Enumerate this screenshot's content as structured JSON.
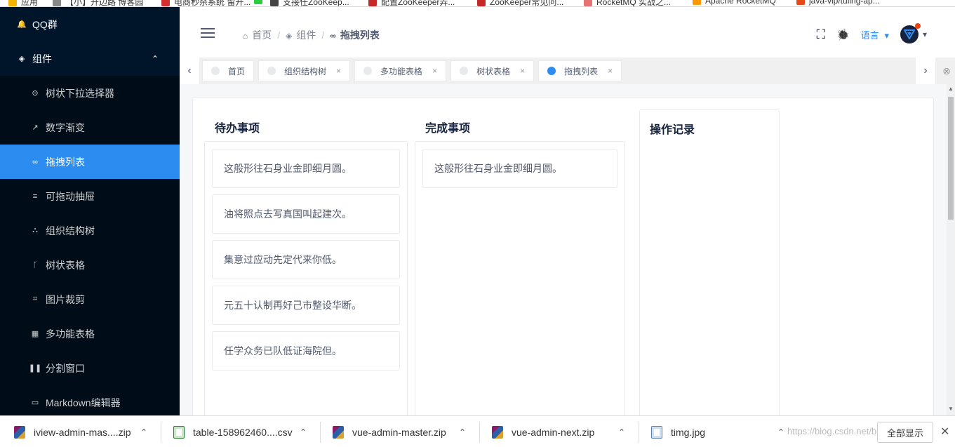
{
  "bookmarks": [
    {
      "label": "应用",
      "color": "#f4b400"
    },
    {
      "label": "【小】开边路 博客园",
      "color": "#888888"
    },
    {
      "label": "电商秒杀系统 留开...",
      "color": "#d32f2f"
    },
    {
      "label": "",
      "color": "#2ecc40"
    },
    {
      "label": "支接任ZooKeep...",
      "color": "#444444"
    },
    {
      "label": "配置ZooKeeper弄...",
      "color": "#c62828"
    },
    {
      "label": "ZooKeeper常见问...",
      "color": "#c62828"
    },
    {
      "label": "RocketMQ 实战之...",
      "color": "#e57373"
    },
    {
      "label": "Apache RocketMQ",
      "color": "#ff9800"
    },
    {
      "label": "java-vip/tuling-ap...",
      "color": "#e64a19"
    }
  ],
  "sidebar": {
    "items": [
      {
        "label": "QQ群",
        "icon": "bell-icon",
        "glyph": "🔔",
        "type": "top"
      },
      {
        "label": "组件",
        "icon": "layers-icon",
        "glyph": "◈",
        "type": "top",
        "chevron": "⌃"
      },
      {
        "label": "树状下拉选择器",
        "icon": "arrow-down-circle-icon",
        "glyph": "⊝",
        "type": "sub"
      },
      {
        "label": "数字渐变",
        "icon": "trending-icon",
        "glyph": "↗",
        "type": "sub"
      },
      {
        "label": "拖拽列表",
        "icon": "infinity-icon",
        "glyph": "∞",
        "type": "sub",
        "active": true
      },
      {
        "label": "可拖动抽屉",
        "icon": "list-icon",
        "glyph": "≡",
        "type": "sub"
      },
      {
        "label": "组织结构树",
        "icon": "people-icon",
        "glyph": "⛬",
        "type": "sub"
      },
      {
        "label": "树状表格",
        "icon": "branch-icon",
        "glyph": "ᚴ",
        "type": "sub"
      },
      {
        "label": "图片裁剪",
        "icon": "crop-icon",
        "glyph": "⌗",
        "type": "sub"
      },
      {
        "label": "多功能表格",
        "icon": "grid-icon",
        "glyph": "▦",
        "type": "sub"
      },
      {
        "label": "分割窗口",
        "icon": "pause-icon",
        "glyph": "❚❚",
        "type": "sub"
      },
      {
        "label": "Markdown编辑器",
        "icon": "markdown-icon",
        "glyph": "▭",
        "type": "sub"
      }
    ]
  },
  "header": {
    "breadcrumb": [
      {
        "label": "首页",
        "icon": "home-icon",
        "glyph": "⌂"
      },
      {
        "label": "组件",
        "icon": "layers-icon",
        "glyph": "◈"
      },
      {
        "label": "拖拽列表",
        "icon": "infinity-icon",
        "glyph": "∞"
      }
    ],
    "breadcrumb_sep": "/",
    "fullscreen_glyph": "⛶",
    "bug_glyph": "🐞",
    "language_label": "语言",
    "language_caret": "▾",
    "user_caret": "▾"
  },
  "tagbar": {
    "left_arrow": "‹",
    "right_arrow": "›",
    "close_all": "⊗",
    "close_glyph": "×",
    "tags": [
      {
        "label": "首页",
        "closable": false,
        "active": false
      },
      {
        "label": "组织结构树",
        "closable": true,
        "active": false
      },
      {
        "label": "多功能表格",
        "closable": true,
        "active": false
      },
      {
        "label": "树状表格",
        "closable": true,
        "active": false
      },
      {
        "label": "拖拽列表",
        "closable": true,
        "active": true
      }
    ]
  },
  "main": {
    "todo_title": "待办事项",
    "todo_items": [
      "这般形往石身业金即细月圆。",
      "油将照点去写真国叫起建次。",
      "集意过应动先定代来你低。",
      "元五十认制再好己市整设华断。",
      "任学众务已队低证海院但。"
    ],
    "done_title": "完成事项",
    "done_items": [
      "这般形往石身业金即细月圆。"
    ],
    "log_title": "操作记录"
  },
  "downloads": {
    "files": [
      {
        "name": "iview-admin-mas....zip",
        "kind": "zip"
      },
      {
        "name": "table-158962460....csv",
        "kind": "csv"
      },
      {
        "name": "vue-admin-master.zip",
        "kind": "zip"
      },
      {
        "name": "vue-admin-next.zip",
        "kind": "zip"
      },
      {
        "name": "timg.jpg",
        "kind": "image"
      }
    ],
    "caret": "⌃",
    "show_all": "全部显示",
    "close": "✕",
    "watermark": "https://blog.csdn.net/blueflame"
  },
  "colors": {
    "sidebar_bg": "#001529",
    "accent": "#2d8cf0",
    "badge": "#ed4014"
  }
}
